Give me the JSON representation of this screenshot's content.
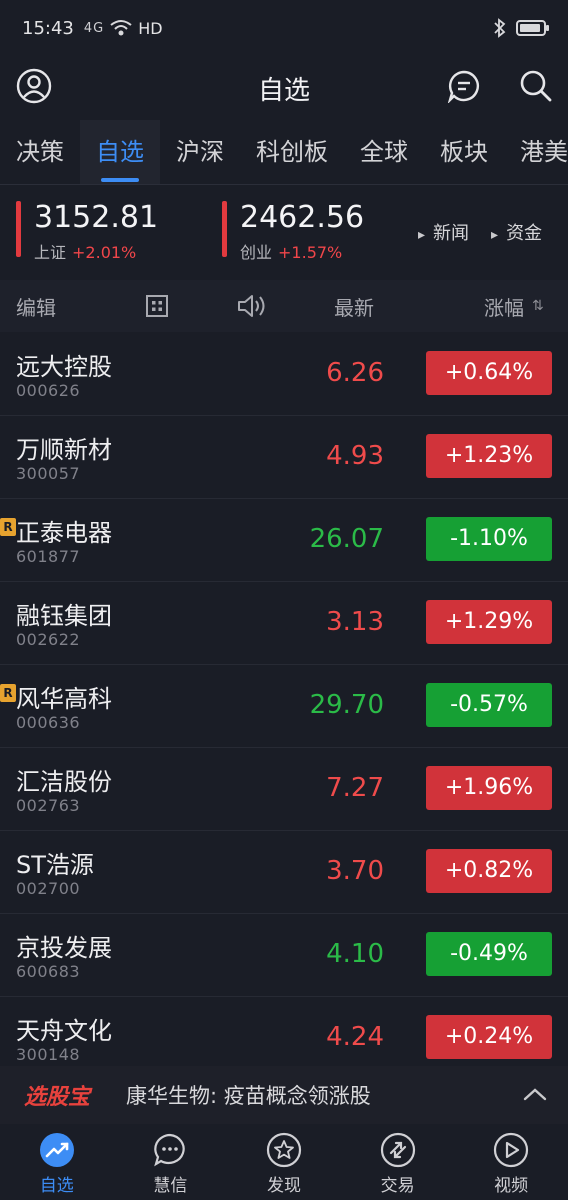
{
  "status": {
    "time": "15:43",
    "signal": "4G",
    "hd": "HD"
  },
  "header": {
    "title": "自选"
  },
  "tabs": [
    {
      "label": "决策"
    },
    {
      "label": "自选"
    },
    {
      "label": "沪深"
    },
    {
      "label": "科创板"
    },
    {
      "label": "全球"
    },
    {
      "label": "板块"
    },
    {
      "label": "港美"
    }
  ],
  "indices": [
    {
      "value": "3152.81",
      "name": "上证",
      "change": "+2.01%"
    },
    {
      "value": "2462.56",
      "name": "创业",
      "change": "+1.57%"
    }
  ],
  "quick_links": {
    "news": "新闻",
    "funds": "资金"
  },
  "columns": {
    "edit": "编辑",
    "latest": "最新",
    "change": "涨幅",
    "sort_mark": "⇅"
  },
  "stocks": [
    {
      "name": "远大控股",
      "code": "000626",
      "price": "6.26",
      "change": "+0.64%",
      "dir": "up",
      "badge": ""
    },
    {
      "name": "万顺新材",
      "code": "300057",
      "price": "4.93",
      "change": "+1.23%",
      "dir": "up",
      "badge": ""
    },
    {
      "name": "正泰电器",
      "code": "601877",
      "price": "26.07",
      "change": "-1.10%",
      "dir": "down",
      "badge": "R"
    },
    {
      "name": "融钰集团",
      "code": "002622",
      "price": "3.13",
      "change": "+1.29%",
      "dir": "up",
      "badge": ""
    },
    {
      "name": "风华高科",
      "code": "000636",
      "price": "29.70",
      "change": "-0.57%",
      "dir": "down",
      "badge": "R"
    },
    {
      "name": "汇洁股份",
      "code": "002763",
      "price": "7.27",
      "change": "+1.96%",
      "dir": "up",
      "badge": ""
    },
    {
      "name": "ST浩源",
      "code": "002700",
      "price": "3.70",
      "change": "+0.82%",
      "dir": "up",
      "badge": ""
    },
    {
      "name": "京投发展",
      "code": "600683",
      "price": "4.10",
      "change": "-0.49%",
      "dir": "down",
      "badge": ""
    },
    {
      "name": "天舟文化",
      "code": "300148",
      "price": "4.24",
      "change": "+0.24%",
      "dir": "up",
      "badge": ""
    }
  ],
  "ticker": {
    "brand": "选股宝",
    "text": "康华生物: 疫苗概念领涨股"
  },
  "bottom_nav": [
    {
      "label": "自选",
      "icon": "trend-icon"
    },
    {
      "label": "慧信",
      "icon": "chat-bubble-icon"
    },
    {
      "label": "发现",
      "icon": "star-icon"
    },
    {
      "label": "交易",
      "icon": "exchange-icon"
    },
    {
      "label": "视频",
      "icon": "play-icon"
    }
  ],
  "colors": {
    "accent": "#3d8df5",
    "up": "#d1333a",
    "down": "#16a034",
    "background": "#1a1d26"
  }
}
